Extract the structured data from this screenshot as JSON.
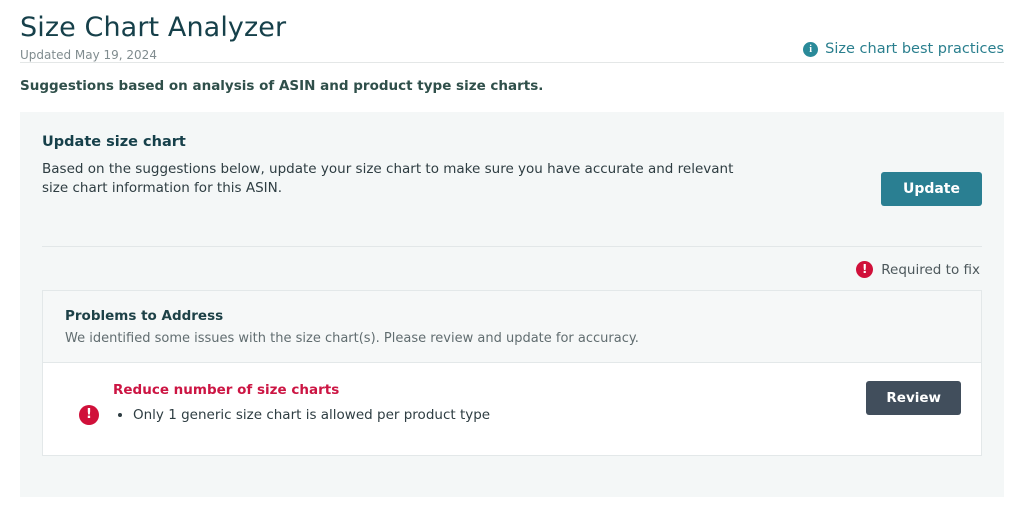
{
  "header": {
    "title": "Size Chart Analyzer",
    "updated": "Updated May 19, 2024",
    "best_practices_link": "Size chart best practices",
    "info_icon_glyph": "i",
    "subtitle": "Suggestions based on analysis of ASIN and product type size charts."
  },
  "update_card": {
    "title": "Update size chart",
    "body": "Based on the suggestions below, update your size chart to make sure you have accurate and relevant size chart information for this ASIN.",
    "update_button": "Update",
    "required_to_fix": "Required to fix",
    "alert_icon_glyph": "!"
  },
  "problems_panel": {
    "title": "Problems to Address",
    "subtitle": "We identified some issues with the size chart(s). Please review and update for accuracy.",
    "items": [
      {
        "title": "Reduce number of size charts",
        "detail": "Only 1 generic size chart is allowed per product type",
        "review_button": "Review",
        "alert_icon_glyph": "!"
      }
    ]
  },
  "colors": {
    "accent_teal": "#2a7f92",
    "link_teal": "#2a7f8e",
    "alert_red": "#d0103a",
    "problem_red": "#cc1543",
    "review_slate": "#414e5c",
    "card_bg": "#f4f7f7",
    "title_ink": "#16404a"
  }
}
